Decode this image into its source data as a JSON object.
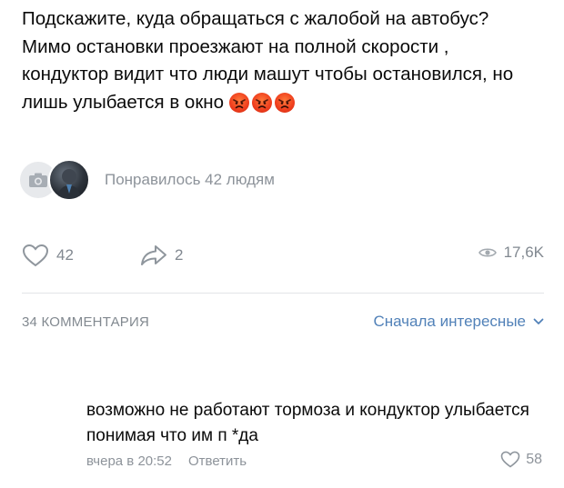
{
  "post": {
    "text": "Подскажите, куда обращаться с жалобой на автобус? Мимо остановки проезжают на полной скорости , кондуктор видит что люди машут чтобы остановился, но лишь улыбается в окно",
    "emojis": [
      "angry-face-icon",
      "angry-face-icon",
      "angry-face-icon"
    ]
  },
  "likes_summary": {
    "text": "Понравилось 42 людям"
  },
  "actions": {
    "likes": "42",
    "shares": "2",
    "views": "17,6K"
  },
  "comments_header": {
    "count_label": "34 КОММЕНТАРИЯ",
    "sort_label": "Сначала интересные"
  },
  "comment": {
    "text": "возможно не работают тормоза и кондуктор улыбается понимая что им п *да",
    "time": "вчера в 20:52",
    "reply_label": "Ответить",
    "likes": "58"
  },
  "colors": {
    "accent": "#5181b8",
    "muted": "#8d939a",
    "divider": "#e3e5e8"
  }
}
